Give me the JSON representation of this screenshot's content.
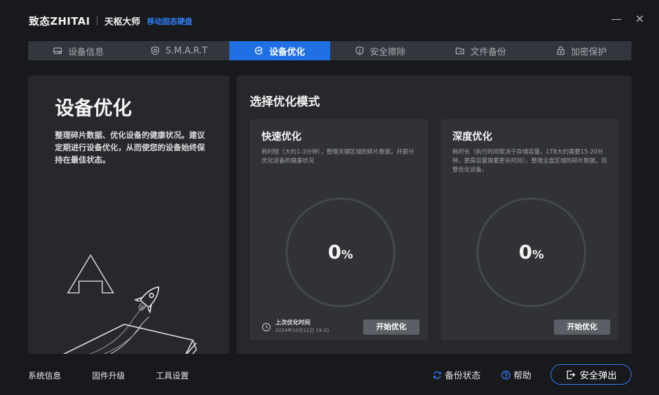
{
  "titlebar": {
    "brand": "致态ZHITAI",
    "product": "天枢大师",
    "subtitle": "移动固态硬盘",
    "minimize_label": "—",
    "close_label": "✕"
  },
  "tabs": [
    {
      "label": "设备信息",
      "icon": "drive-icon",
      "active": false
    },
    {
      "label": "S.M.A.R.T",
      "icon": "shield-check-icon",
      "active": false
    },
    {
      "label": "设备优化",
      "icon": "optimize-icon",
      "active": true
    },
    {
      "label": "安全擦除",
      "icon": "shield-alert-icon",
      "active": false
    },
    {
      "label": "文件备份",
      "icon": "folder-icon",
      "active": false
    },
    {
      "label": "加密保护",
      "icon": "lock-icon",
      "active": false
    }
  ],
  "left_panel": {
    "title": "设备优化",
    "description": "整理碎片数据、优化设备的健康状况。建议定期进行设备优化，从而使您的设备始终保持在最佳状态。"
  },
  "right_panel": {
    "title": "选择优化模式",
    "quick": {
      "name": "快速优化",
      "description": "耗时短（大约1-3分钟），整理关键区域的碎片数据，并部分优化设备的健康状况",
      "progress_number": "0",
      "progress_unit": "%",
      "last_time_label": "上次优化时间",
      "last_time_value": "2024年10月11日 19:31",
      "button": "开始优化"
    },
    "deep": {
      "name": "深度优化",
      "description": "耗时长（执行时间取决于存储容量，1TB大约需要15-20分钟，更高容量需要更长时间），整理全盘区域的碎片数据，完整优化设备。",
      "progress_number": "0",
      "progress_unit": "%",
      "button": "开始优化"
    }
  },
  "footer": {
    "system_info": "系统信息",
    "firmware": "固件升级",
    "tools": "工具设置",
    "backup_status": "备份状态",
    "help": "帮助",
    "eject": "安全弹出"
  },
  "colors": {
    "accent": "#1f6fe5",
    "background": "#18191c",
    "panel": "#26282c",
    "card": "#303236"
  }
}
